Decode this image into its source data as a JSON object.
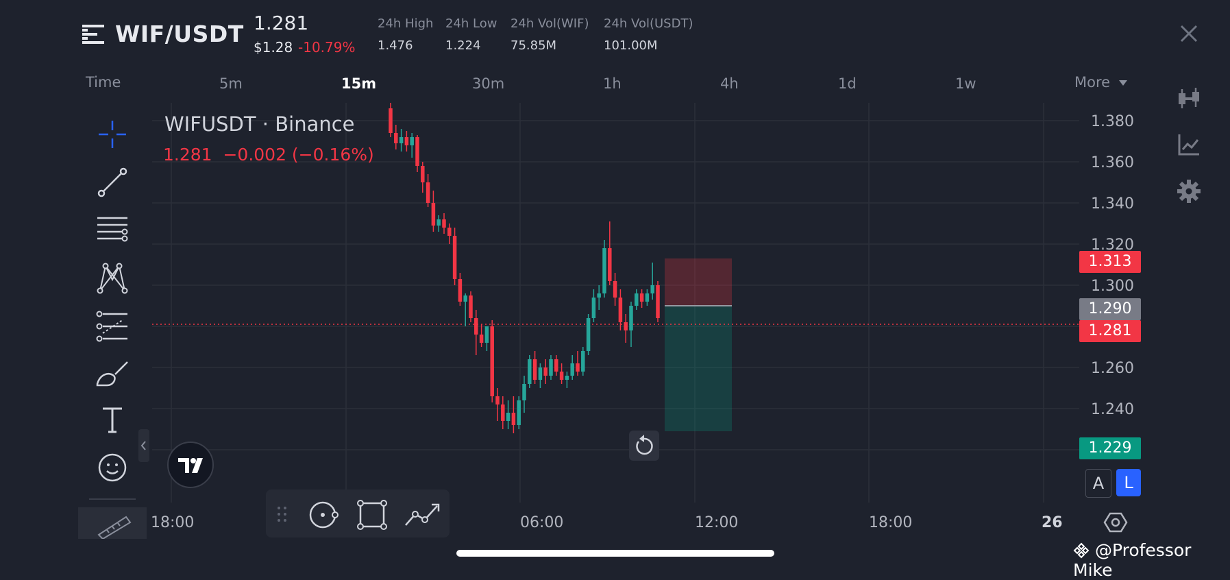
{
  "header": {
    "pair": "WIF/USDT",
    "price": "1.281",
    "price_usd": "$1.28",
    "change_pct": "-10.79%",
    "stats": [
      {
        "label": "24h High",
        "value": "1.476"
      },
      {
        "label": "24h Low",
        "value": "1.224"
      },
      {
        "label": "24h Vol(WIF)",
        "value": "75.85M"
      },
      {
        "label": "24h Vol(USDT)",
        "value": "101.00M"
      }
    ]
  },
  "timeframes": {
    "time_label": "Time",
    "items": [
      "5m",
      "15m",
      "30m",
      "1h",
      "4h",
      "1d",
      "1w"
    ],
    "active": "15m",
    "more_label": "More"
  },
  "legend": {
    "title": "WIFUSDT · Binance",
    "values": "1.281  −0.002 (−0.16%)"
  },
  "price_tags": {
    "stop": "1.313",
    "entry": "1.290",
    "current": "1.281",
    "target": "1.229"
  },
  "scale_buttons": {
    "auto": "A",
    "log": "L"
  },
  "watermark": "@Professor Mike",
  "colors": {
    "background": "#1e222d",
    "up": "#26a69a",
    "down": "#f23645",
    "accent": "#2962ff"
  },
  "chart_data": {
    "type": "candlestick",
    "symbol": "WIFUSDT",
    "exchange": "Binance",
    "interval": "15m",
    "y_ticks": [
      1.38,
      1.36,
      1.34,
      1.32,
      1.3,
      1.26,
      1.24
    ],
    "x_ticks": [
      "18:00",
      "06:00",
      "12:00",
      "18:00",
      "26"
    ],
    "ylim": [
      1.222,
      1.39
    ],
    "last_price": 1.281,
    "position": {
      "type": "short",
      "entry": 1.29,
      "stop": 1.313,
      "target": 1.229
    },
    "candles": [
      [
        1.386,
        1.391,
        1.372,
        1.374
      ],
      [
        1.374,
        1.378,
        1.366,
        1.369
      ],
      [
        1.369,
        1.376,
        1.365,
        1.372
      ],
      [
        1.372,
        1.375,
        1.365,
        1.368
      ],
      [
        1.368,
        1.374,
        1.362,
        1.372
      ],
      [
        1.372,
        1.373,
        1.355,
        1.358
      ],
      [
        1.358,
        1.36,
        1.345,
        1.35
      ],
      [
        1.35,
        1.354,
        1.338,
        1.34
      ],
      [
        1.34,
        1.346,
        1.326,
        1.329
      ],
      [
        1.329,
        1.334,
        1.326,
        1.332
      ],
      [
        1.332,
        1.335,
        1.325,
        1.328
      ],
      [
        1.328,
        1.33,
        1.32,
        1.324
      ],
      [
        1.324,
        1.328,
        1.3,
        1.303
      ],
      [
        1.303,
        1.306,
        1.29,
        1.292
      ],
      [
        1.292,
        1.296,
        1.28,
        1.295
      ],
      [
        1.295,
        1.297,
        1.282,
        1.284
      ],
      [
        1.284,
        1.288,
        1.266,
        1.276
      ],
      [
        1.276,
        1.281,
        1.27,
        1.272
      ],
      [
        1.272,
        1.28,
        1.268,
        1.28
      ],
      [
        1.28,
        1.283,
        1.243,
        1.246
      ],
      [
        1.246,
        1.25,
        1.234,
        1.242
      ],
      [
        1.242,
        1.246,
        1.23,
        1.234
      ],
      [
        1.234,
        1.244,
        1.23,
        1.238
      ],
      [
        1.238,
        1.246,
        1.228,
        1.232
      ],
      [
        1.232,
        1.246,
        1.23,
        1.244
      ],
      [
        1.244,
        1.256,
        1.238,
        1.252
      ],
      [
        1.252,
        1.266,
        1.25,
        1.264
      ],
      [
        1.264,
        1.268,
        1.252,
        1.254
      ],
      [
        1.254,
        1.262,
        1.25,
        1.26
      ],
      [
        1.26,
        1.264,
        1.252,
        1.256
      ],
      [
        1.256,
        1.266,
        1.254,
        1.264
      ],
      [
        1.264,
        1.266,
        1.256,
        1.258
      ],
      [
        1.258,
        1.262,
        1.252,
        1.254
      ],
      [
        1.254,
        1.258,
        1.25,
        1.256
      ],
      [
        1.256,
        1.266,
        1.254,
        1.262
      ],
      [
        1.262,
        1.268,
        1.256,
        1.258
      ],
      [
        1.258,
        1.27,
        1.256,
        1.268
      ],
      [
        1.268,
        1.286,
        1.266,
        1.284
      ],
      [
        1.284,
        1.298,
        1.282,
        1.294
      ],
      [
        1.294,
        1.3,
        1.288,
        1.296
      ],
      [
        1.296,
        1.322,
        1.294,
        1.318
      ],
      [
        1.318,
        1.331,
        1.3,
        1.302
      ],
      [
        1.302,
        1.306,
        1.29,
        1.294
      ],
      [
        1.294,
        1.298,
        1.278,
        1.282
      ],
      [
        1.282,
        1.286,
        1.272,
        1.278
      ],
      [
        1.278,
        1.292,
        1.27,
        1.29
      ],
      [
        1.29,
        1.298,
        1.288,
        1.296
      ],
      [
        1.296,
        1.298,
        1.289,
        1.292
      ],
      [
        1.292,
        1.298,
        1.29,
        1.296
      ],
      [
        1.296,
        1.311,
        1.293,
        1.3
      ],
      [
        1.3,
        1.302,
        1.282,
        1.284
      ]
    ]
  }
}
